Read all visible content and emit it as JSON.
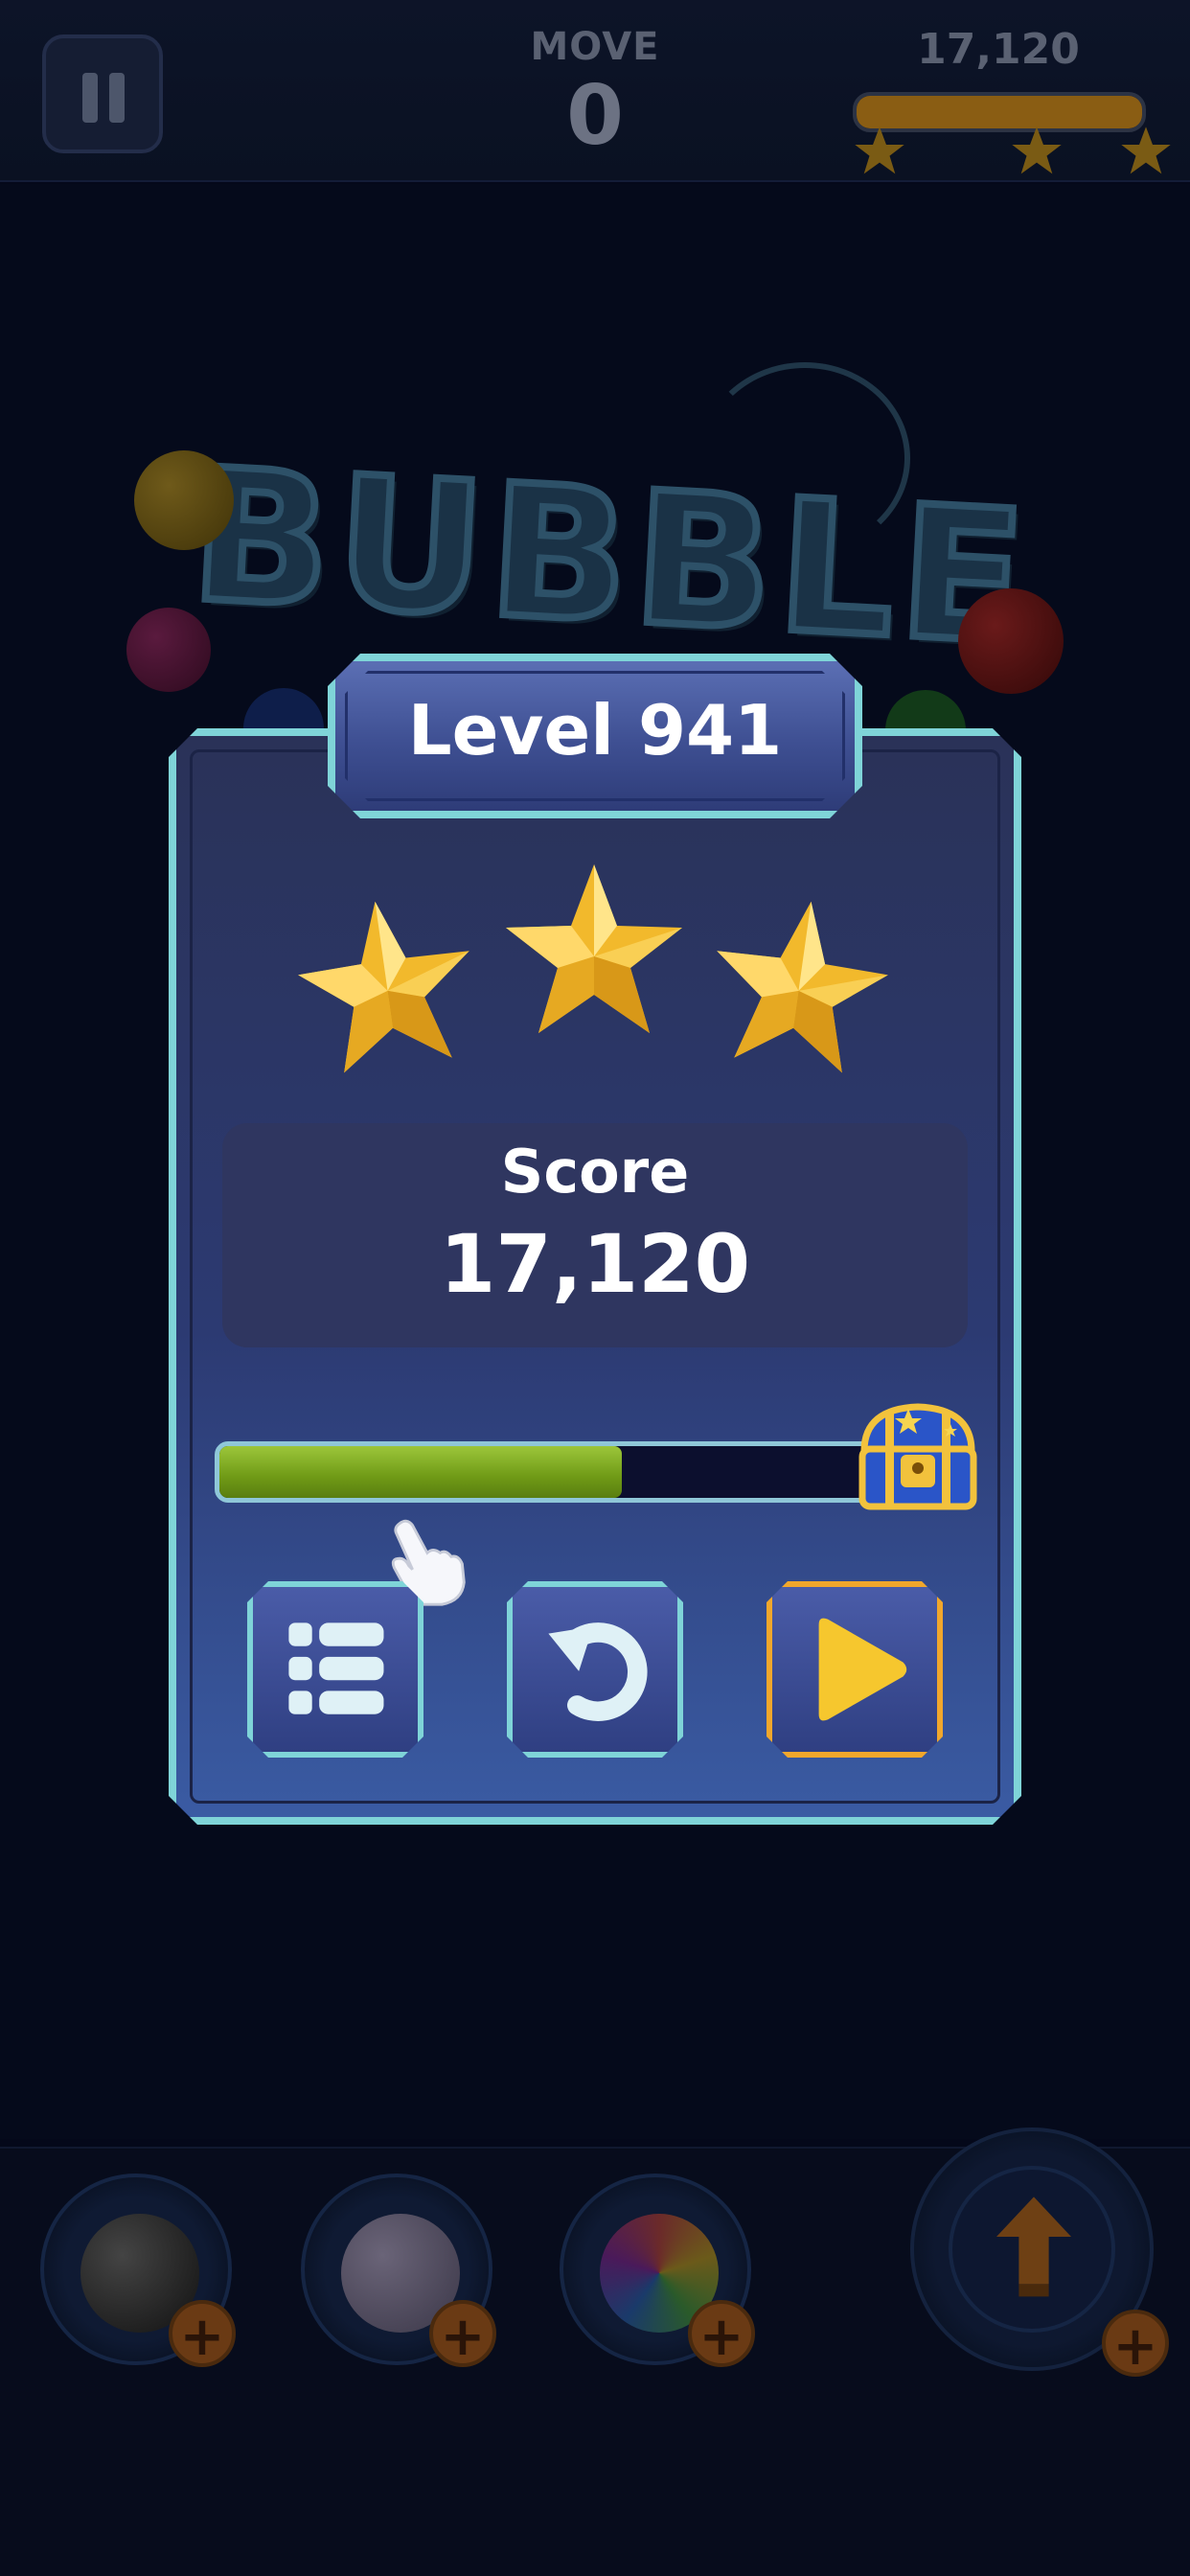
{
  "hud": {
    "move_label": "MOVE",
    "move_value": "0",
    "score": "17,120",
    "progress_fraction": 1.0,
    "stars_earned": 3,
    "pause_icon": "pause-icon"
  },
  "logo": {
    "text": "BUBBLE"
  },
  "dialog": {
    "title": "Level 941",
    "stars_earned": 3,
    "stars_total": 3,
    "score_label": "Score",
    "score_value": "17,120",
    "chest_progress_fraction": 0.6,
    "buttons": {
      "menu_icon": "list-icon",
      "retry_icon": "retry-icon",
      "next_icon": "play-icon"
    }
  },
  "boosters": [
    {
      "name": "bomb",
      "icon": "bomb-icon",
      "add": "+"
    },
    {
      "name": "lightning",
      "icon": "lightning-ball-icon",
      "add": "+"
    },
    {
      "name": "rainbow",
      "icon": "rainbow-ball-icon",
      "add": "+"
    },
    {
      "name": "rocket",
      "icon": "rocket-icon",
      "add": "+"
    }
  ],
  "colors": {
    "dialog_border": "#7fd4d8",
    "play_border": "#f1a72c",
    "progress_green": "#8cb82a",
    "star_gold": "#f4c542"
  }
}
